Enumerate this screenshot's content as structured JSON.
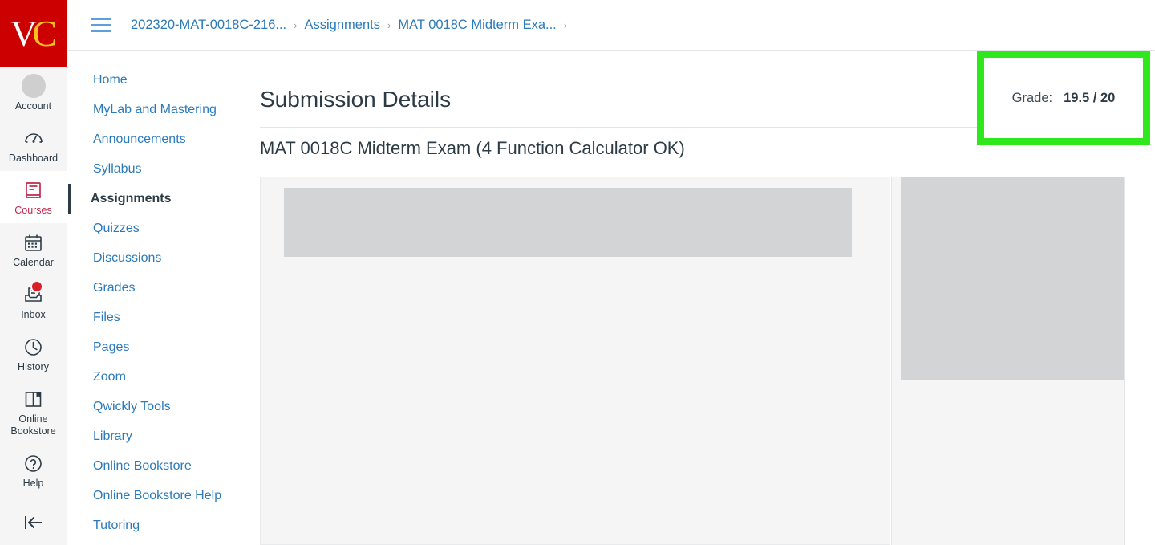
{
  "brand": {
    "logo_text_v": "V",
    "logo_text_c": "C",
    "logo_bg": "#cc0000",
    "logo_v_color": "#ffffff",
    "logo_c_color": "#ffc21e"
  },
  "global_nav": {
    "items": [
      {
        "label": "Account",
        "icon": "avatar-icon",
        "active": false,
        "badge": ""
      },
      {
        "label": "Dashboard",
        "icon": "dashboard-icon",
        "active": false,
        "badge": ""
      },
      {
        "label": "Courses",
        "icon": "courses-book-icon",
        "active": true,
        "badge": ""
      },
      {
        "label": "Calendar",
        "icon": "calendar-icon",
        "active": false,
        "badge": ""
      },
      {
        "label": "Inbox",
        "icon": "inbox-icon",
        "active": false,
        "badge": "unread"
      },
      {
        "label": "History",
        "icon": "clock-icon",
        "active": false,
        "badge": ""
      },
      {
        "label": "Online Bookstore",
        "icon": "book-open-icon",
        "active": false,
        "badge": ""
      },
      {
        "label": "Help",
        "icon": "question-circle-icon",
        "active": false,
        "badge": ""
      }
    ],
    "collapse_icon": "collapse-left-icon",
    "active_color": "#c0294c"
  },
  "topbar": {
    "menu_icon": "hamburger-menu-icon",
    "breadcrumb": [
      "202320-MAT-0018C-216...",
      "Assignments",
      "MAT 0018C Midterm Exa..."
    ],
    "separator": "›",
    "trailing_separator": "›"
  },
  "course_nav": {
    "items": [
      {
        "label": "Home",
        "active": false
      },
      {
        "label": "MyLab and Mastering",
        "active": false
      },
      {
        "label": "Announcements",
        "active": false
      },
      {
        "label": "Syllabus",
        "active": false
      },
      {
        "label": "Assignments",
        "active": true
      },
      {
        "label": "Quizzes",
        "active": false
      },
      {
        "label": "Discussions",
        "active": false
      },
      {
        "label": "Grades",
        "active": false
      },
      {
        "label": "Files",
        "active": false
      },
      {
        "label": "Pages",
        "active": false
      },
      {
        "label": "Zoom",
        "active": false
      },
      {
        "label": "Qwickly Tools",
        "active": false
      },
      {
        "label": "Library",
        "active": false
      },
      {
        "label": "Online Bookstore",
        "active": false
      },
      {
        "label": "Online Bookstore Help",
        "active": false
      },
      {
        "label": "Tutoring",
        "active": false
      }
    ],
    "link_color": "#2b7abc"
  },
  "main": {
    "page_title": "Submission Details",
    "assignment_title": "MAT 0018C Midterm Exam (4 Function Calculator OK)",
    "grade": {
      "label": "Grade:",
      "value": "19.5 / 20",
      "score": "19.5",
      "points_possible": "20",
      "highlight_color": "#2ee81c"
    },
    "preview": {
      "placeholder_color": "#d2d4d6",
      "panel_color": "#f5f5f5"
    }
  }
}
